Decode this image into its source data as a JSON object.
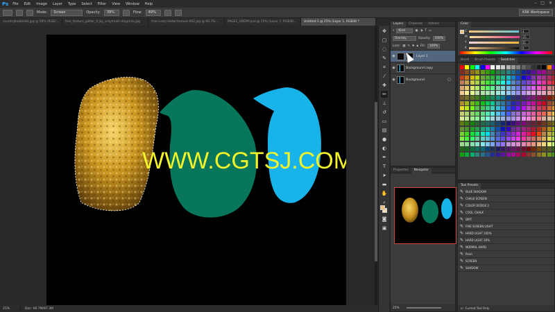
{
  "app": {
    "logo": "Ps"
  },
  "menu": [
    "File",
    "Edit",
    "Image",
    "Layer",
    "Type",
    "Select",
    "Filter",
    "View",
    "Window",
    "Help"
  ],
  "window_controls": [
    "–",
    "□",
    "✕"
  ],
  "options": {
    "mode_label": "Mode:",
    "mode_value": "Screen",
    "opacity_label": "Opacity:",
    "opacity_value": "39%",
    "flow_label": "Flow:",
    "flow_value": "49%",
    "workspace": "KRK Workspace"
  },
  "doc_tabs": [
    "countrybubble04.jpg @ 50% (RGB/...",
    "free_feature_glitter_lt_by_sckymush-d3pph3x.jpg",
    "free-rusty-metal-texture-002.jpg @ 66.7%...",
    "PAGE1_UDEMY.psd @ 25% (Layer 7, RGB/8)...",
    "Untitled-1 @ 25% (Layer 1, RGB/8) *"
  ],
  "canvas": {
    "watermark": "WWW.CGTSJ.COM"
  },
  "status": {
    "zoom": "25%",
    "doc": "Doc: 66.7M/97.3M"
  },
  "layers_panel": {
    "tabs": [
      "Layers",
      "Channels",
      "Actions"
    ],
    "kind_label": "Kind",
    "blend_mode": "Overlay",
    "opacity_label": "Opacity:",
    "opacity_value": "100%",
    "lock_label": "Lock:",
    "fill_label": "Fill:",
    "fill_value": "100%",
    "layers": [
      {
        "name": "Layer 1",
        "selected": true
      },
      {
        "name": "Background copy",
        "selected": false
      },
      {
        "name": "Background",
        "selected": false
      }
    ]
  },
  "color_panel": {
    "tab": "Color",
    "channels": [
      {
        "label": "C",
        "value": "4"
      },
      {
        "label": "M",
        "value": "25"
      },
      {
        "label": "Y",
        "value": "55"
      },
      {
        "label": "K",
        "value": "0"
      }
    ]
  },
  "swatches_panel": {
    "tabs": [
      "Brush",
      "Brush Presets",
      "Swatches"
    ]
  },
  "navigator_panel": {
    "tabs": [
      "Properties",
      "Navigator"
    ],
    "zoom": "25%"
  },
  "tool_presets": {
    "title": "Tool Presets",
    "items": [
      "BLUE SHADOW",
      "CHALK SCREEN",
      "COLOR DODGE 2",
      "COOL CHALK",
      "DIRT",
      "FIRE SCREEN LIGHT",
      "HARD LIGHT 100%",
      "HARD LIGHT 20%",
      "NORMAL HARD",
      "Paint",
      "SCREEN",
      "SHADOW"
    ],
    "footer": "Current Tool Only"
  },
  "colors": {
    "gold": "#c9941e",
    "green": "#07765a",
    "blue": "#18b3e8",
    "watermark": "#f3f32a",
    "selected_layer": "#52677f",
    "fg_swatch": "#f2c07c"
  }
}
